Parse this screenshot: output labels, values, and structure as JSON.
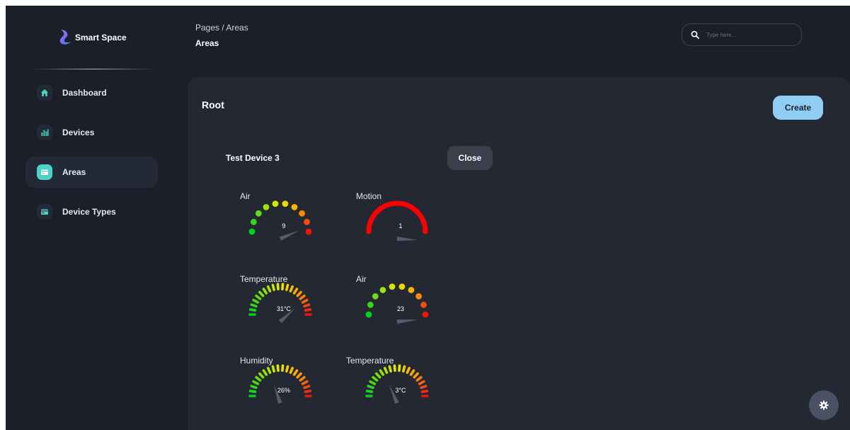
{
  "app": {
    "name": "Smart Space"
  },
  "sidebar": {
    "items": [
      {
        "label": "Dashboard",
        "icon": "home-icon",
        "active": false
      },
      {
        "label": "Devices",
        "icon": "bar-chart-icon",
        "active": false
      },
      {
        "label": "Areas",
        "icon": "card-icon",
        "active": true
      },
      {
        "label": "Device Types",
        "icon": "card-icon",
        "active": false
      }
    ]
  },
  "header": {
    "breadcrumb": "Pages / Areas",
    "title": "Areas",
    "search_placeholder": "Type here..."
  },
  "main": {
    "root_title": "Root",
    "create_label": "Create",
    "device": {
      "name": "Test Device 3",
      "close_label": "Close",
      "gauges": [
        {
          "label": "Air",
          "value": "9",
          "level": 0.85,
          "style": "dots"
        },
        {
          "label": "Motion",
          "value": "1",
          "level": 1.0,
          "style": "arc"
        },
        {
          "label": "Temperature",
          "value": "31°C",
          "level": 0.75,
          "style": "dashes"
        },
        {
          "label": "Air",
          "value": "23",
          "level": 0.95,
          "style": "dots"
        },
        {
          "label": "Humidity",
          "value": "26%",
          "level": 0.4,
          "style": "dashes"
        },
        {
          "label": "Temperature",
          "value": "3°C",
          "level": 0.38,
          "style": "dashes"
        }
      ]
    }
  },
  "colors": {
    "accent": "#4fd1c5",
    "create_button": "#90cdf4",
    "background": "#1a1f29",
    "card": "#232833"
  }
}
